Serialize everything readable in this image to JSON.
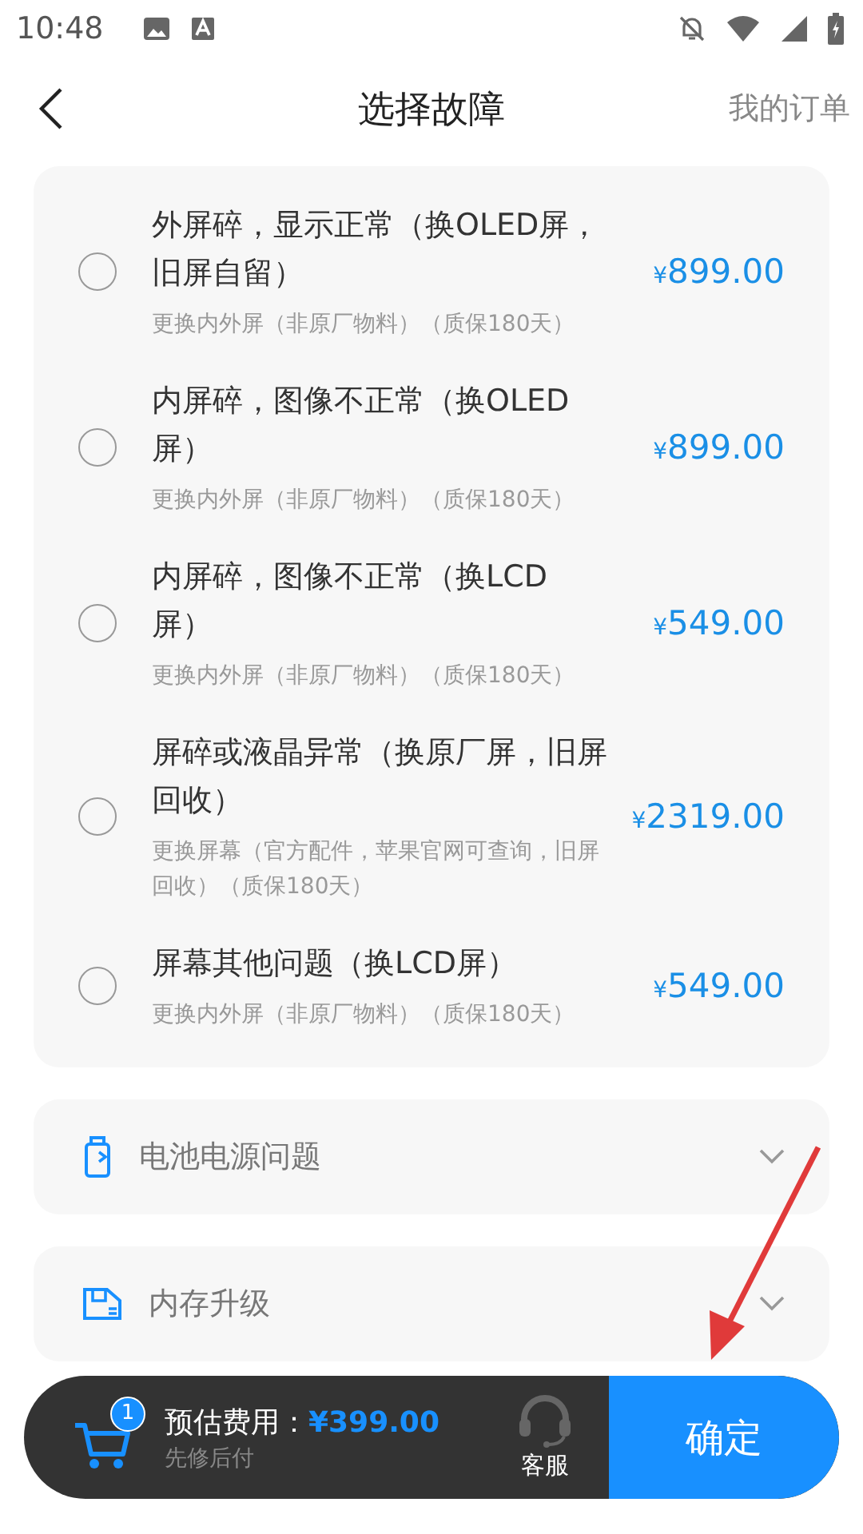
{
  "status_bar": {
    "time": "10:48"
  },
  "header": {
    "title": "选择故障",
    "action": "我的订单"
  },
  "options": [
    {
      "title": "外屏碎，显示正常（换OLED屏，旧屏自留）",
      "note": "更换内外屏（非原厂物料）（质保180天）",
      "price": "¥899.00",
      "selected": false
    },
    {
      "title": "内屏碎，图像不正常（换OLED屏）",
      "note": "更换内外屏（非原厂物料）（质保180天）",
      "price": "¥899.00",
      "selected": false
    },
    {
      "title": "内屏碎，图像不正常（换LCD屏）",
      "note": "更换内外屏（非原厂物料）（质保180天）",
      "price": "¥549.00",
      "selected": false
    },
    {
      "title": "屏碎或液晶异常（换原厂屏，旧屏回收）",
      "note": "更换屏幕（官方配件，苹果官网可查询，旧屏回收）（质保180天）",
      "price": "¥2319.00",
      "selected": false
    },
    {
      "title": "屏幕其他问题（换LCD屏）",
      "note": "更换内外屏（非原厂物料）（质保180天）",
      "price": "¥549.00",
      "selected": false
    }
  ],
  "sections": [
    {
      "kind": "battery",
      "label": "电池电源问题",
      "expanded": false
    },
    {
      "kind": "memory",
      "label": "内存升级",
      "expanded": false
    }
  ],
  "cart": {
    "count": "1",
    "estimate_label": "预估费用：",
    "estimate": "¥399.00",
    "note": "先修后付",
    "service": "客服",
    "confirm": "确定"
  }
}
